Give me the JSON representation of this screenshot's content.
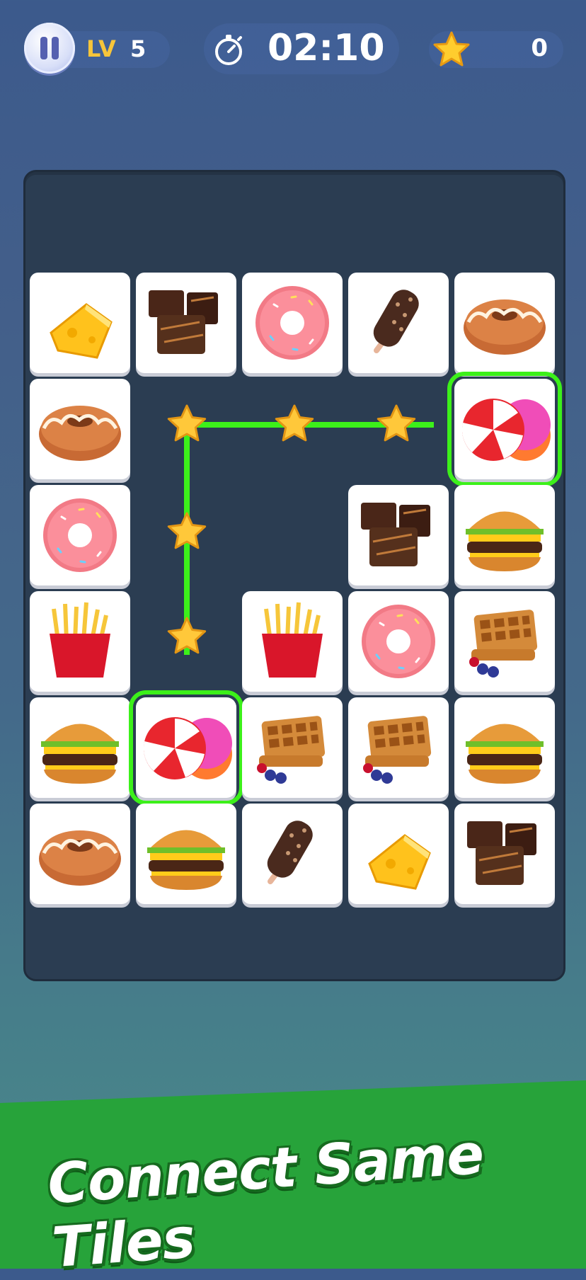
{
  "hud": {
    "level_label": "LV",
    "level_value": "5",
    "timer": "02:10",
    "stars": "0"
  },
  "board": {
    "rows": 6,
    "cols": 5,
    "tiles": [
      [
        "cheese",
        "brownie",
        "donut-pink",
        "ice-cream-bar",
        "bundt-cake"
      ],
      [
        "bundt-cake",
        null,
        null,
        null,
        "candy"
      ],
      [
        "donut-pink",
        null,
        null,
        "brownie",
        "burger"
      ],
      [
        "fries",
        null,
        "fries",
        "donut-pink",
        "waffle"
      ],
      [
        "burger",
        "candy",
        "waffle",
        "waffle",
        "burger"
      ],
      [
        "bundt-cake",
        "burger",
        "ice-cream-bar",
        "cheese",
        "brownie"
      ]
    ],
    "selected": [
      [
        1,
        4
      ],
      [
        4,
        1
      ]
    ]
  },
  "colors": {
    "path": "#3cf01a",
    "star": "#ffc83a",
    "banner": "#27a33a"
  },
  "banner": {
    "title": "Connect Same Tiles"
  }
}
